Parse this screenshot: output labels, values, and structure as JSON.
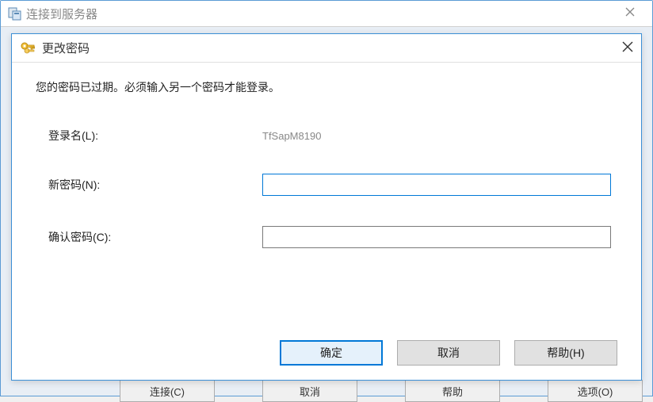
{
  "outer": {
    "title": "连接到服务器",
    "bg_buttons": [
      "连接(C)",
      "取消",
      "帮助",
      "选项(O)"
    ]
  },
  "dialog": {
    "title": "更改密码",
    "message": "您的密码已过期。必须输入另一个密码才能登录。",
    "login_label": "登录名(L):",
    "login_value": "TfSapM8190",
    "newpass_label": "新密码(N):",
    "newpass_value": "",
    "confirm_label": "确认密码(C):",
    "confirm_value": "",
    "ok": "确定",
    "cancel": "取消",
    "help": "帮助(H)"
  }
}
